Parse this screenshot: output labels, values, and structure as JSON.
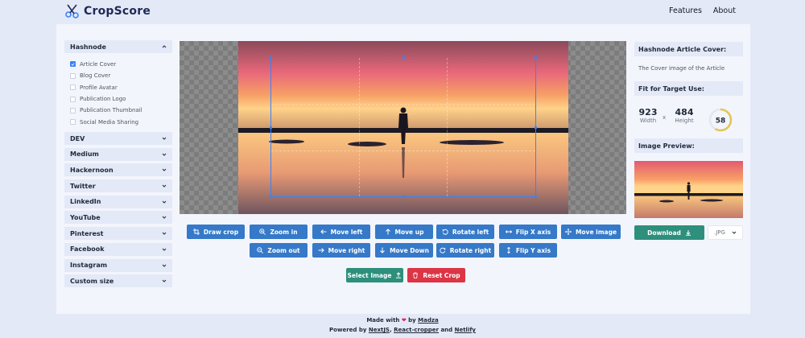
{
  "app": {
    "name": "CropScore",
    "nav": [
      "Features",
      "About"
    ]
  },
  "sidebar": {
    "sections": [
      {
        "label": "Hashnode",
        "expanded": true,
        "options": [
          {
            "label": "Article Cover",
            "checked": true
          },
          {
            "label": "Blog Cover",
            "checked": false
          },
          {
            "label": "Profile Avatar",
            "checked": false
          },
          {
            "label": "Publication Logo",
            "checked": false
          },
          {
            "label": "Publication Thumbnail",
            "checked": false
          },
          {
            "label": "Social Media Sharing",
            "checked": false
          }
        ]
      },
      {
        "label": "DEV",
        "expanded": false
      },
      {
        "label": "Medium",
        "expanded": false
      },
      {
        "label": "Hackernoon",
        "expanded": false
      },
      {
        "label": "Twitter",
        "expanded": false
      },
      {
        "label": "LinkedIn",
        "expanded": false
      },
      {
        "label": "YouTube",
        "expanded": false
      },
      {
        "label": "Pinterest",
        "expanded": false
      },
      {
        "label": "Facebook",
        "expanded": false
      },
      {
        "label": "Instagram",
        "expanded": false
      },
      {
        "label": "Custom size",
        "expanded": false
      }
    ]
  },
  "toolbar": {
    "row1": [
      {
        "label": "Draw crop",
        "icon": "crop-icon"
      },
      {
        "label": "Zoom in",
        "icon": "zoom-in-icon"
      },
      {
        "label": "Move left",
        "icon": "arrow-left-icon"
      },
      {
        "label": "Move up",
        "icon": "arrow-up-icon"
      },
      {
        "label": "Rotate left",
        "icon": "rotate-left-icon"
      },
      {
        "label": "Flip X axis",
        "icon": "flip-x-icon"
      },
      {
        "label": "Move image",
        "icon": "move-icon"
      }
    ],
    "row2": [
      {
        "label": "Zoom out",
        "icon": "zoom-out-icon"
      },
      {
        "label": "Move right",
        "icon": "arrow-right-icon"
      },
      {
        "label": "Move Down",
        "icon": "arrow-down-icon"
      },
      {
        "label": "Rotate right",
        "icon": "rotate-right-icon"
      },
      {
        "label": "Flip Y axis",
        "icon": "flip-y-icon"
      }
    ],
    "select_image": "Select Image",
    "reset_crop": "Reset Crop"
  },
  "panel": {
    "title": "Hashnode Article Cover:",
    "description": "The Cover image of the Article",
    "fit_title": "Fit for Target Use:",
    "width_value": "923",
    "width_label": "Width",
    "times": "x",
    "height_value": "484",
    "height_label": "Height",
    "score": "58",
    "score_fraction": 0.58,
    "preview_title": "Image Preview:",
    "download": "Download",
    "format": ".JPG"
  },
  "footer": {
    "made_with": "Made with",
    "by": "by",
    "author": "Madza",
    "powered_by": "Powered by",
    "tech1": "NextJS",
    "tech2": "React-cropper",
    "and": "and",
    "tech3": "Netlify"
  },
  "colors": {
    "primary": "#3579c8",
    "success": "#2d8f7c",
    "danger": "#dc3545",
    "score_ring": "#e5c453"
  }
}
